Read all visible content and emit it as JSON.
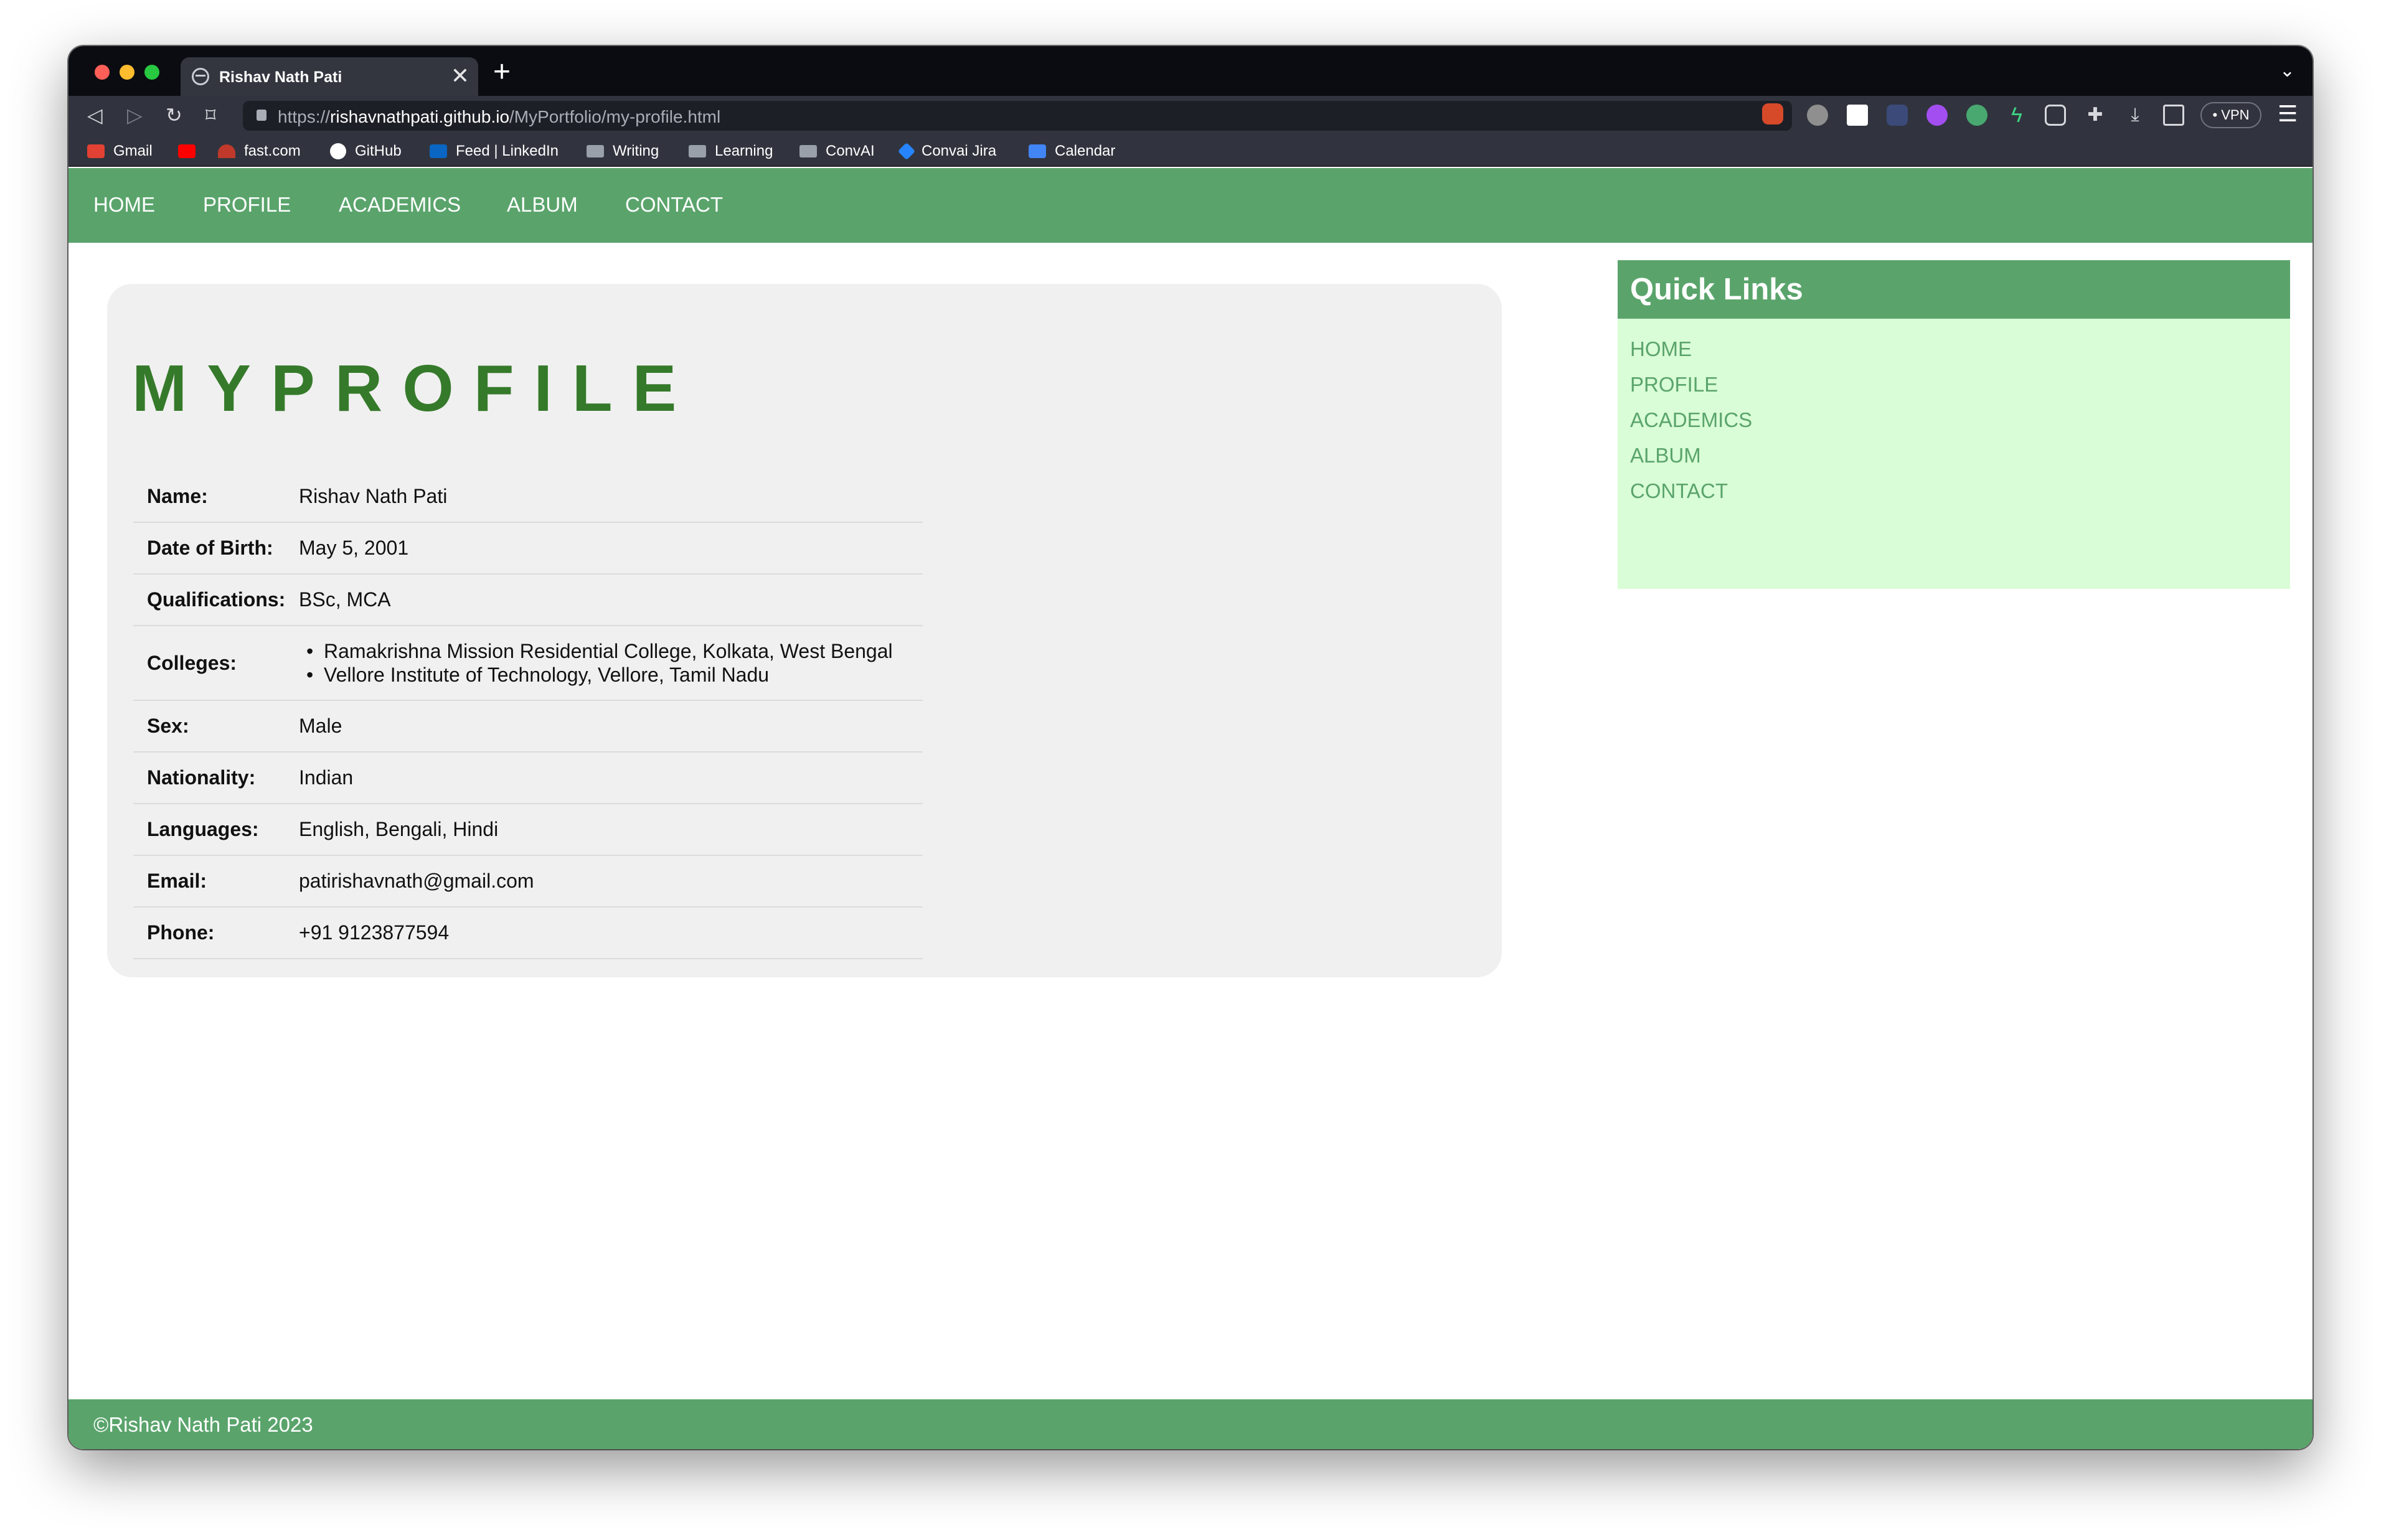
{
  "browser": {
    "tab_title": "Rishav Nath Pati",
    "tab_close": "✕",
    "new_tab": "+",
    "url_scheme": "https://",
    "url_host": "rishavnathpati.github.io",
    "url_path": "/MyPortfolio/my-profile.html",
    "vpn_label": "• VPN",
    "bookmarks": [
      "Gmail",
      "fast.com",
      "GitHub",
      "Feed | LinkedIn",
      "Writing",
      "Learning",
      "ConvAI",
      "Convai Jira",
      "Calendar"
    ]
  },
  "nav": {
    "items": [
      "HOME",
      "PROFILE",
      "ACADEMICS",
      "ALBUM",
      "CONTACT"
    ]
  },
  "profile": {
    "title": "MYPROFILE",
    "rows": [
      {
        "label": "Name:",
        "value": "Rishav Nath Pati"
      },
      {
        "label": "Date of Birth:",
        "value": "May 5, 2001"
      },
      {
        "label": "Qualifications:",
        "value": "BSc, MCA"
      },
      {
        "label": "Colleges:",
        "values": [
          "Ramakrishna Mission Residential College, Kolkata, West Bengal",
          "Vellore Institute of Technology, Vellore, Tamil Nadu"
        ]
      },
      {
        "label": "Sex:",
        "value": "Male"
      },
      {
        "label": "Nationality:",
        "value": "Indian"
      },
      {
        "label": "Languages:",
        "value": "English, Bengali, Hindi"
      },
      {
        "label": "Email:",
        "value": "patirishavnath@gmail.com"
      },
      {
        "label": "Phone:",
        "value": "+91 9123877594"
      }
    ]
  },
  "quick_links": {
    "title": "Quick Links",
    "items": [
      "HOME",
      "PROFILE",
      "ACADEMICS",
      "ALBUM",
      "CONTACT"
    ]
  },
  "footer": {
    "text": "©Rishav Nath Pati 2023"
  },
  "colors": {
    "accent": "#5aa46c",
    "title_green": "#357a2a",
    "quick_bg": "#d9fdd6",
    "card_bg": "#f0f0f0"
  }
}
